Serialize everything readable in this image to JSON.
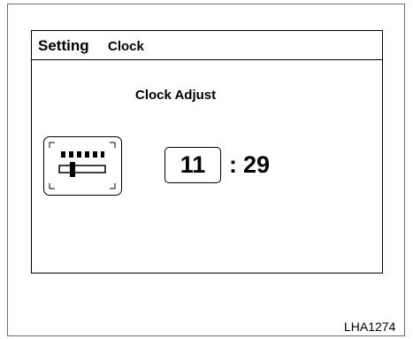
{
  "header": {
    "title": "Setting",
    "subtitle": "Clock"
  },
  "main": {
    "heading": "Clock Adjust",
    "adjust_icon": "slider-adjust-icon",
    "hours": "11",
    "separator": ":",
    "minutes": "29"
  },
  "figure_code": "LHA1274"
}
